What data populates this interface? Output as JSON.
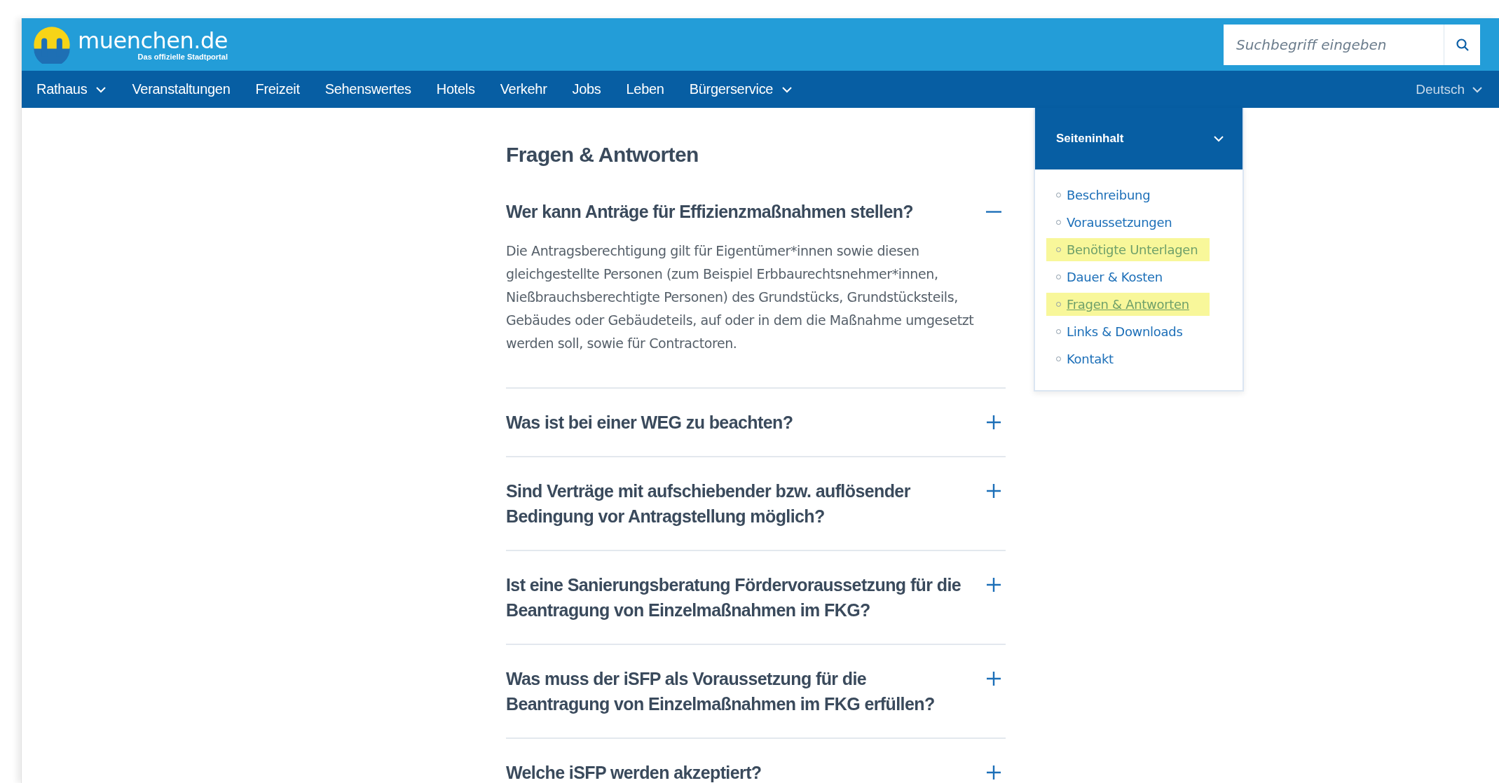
{
  "header": {
    "logo_text": "muenchen.de",
    "logo_tagline": "Das offizielle Stadtportal",
    "search": {
      "placeholder": "Suchbegriff eingeben"
    }
  },
  "nav": {
    "items": [
      {
        "label": "Rathaus",
        "dropdown": true
      },
      {
        "label": "Veranstaltungen",
        "dropdown": false
      },
      {
        "label": "Freizeit",
        "dropdown": false
      },
      {
        "label": "Sehenswertes",
        "dropdown": false
      },
      {
        "label": "Hotels",
        "dropdown": false
      },
      {
        "label": "Verkehr",
        "dropdown": false
      },
      {
        "label": "Jobs",
        "dropdown": false
      },
      {
        "label": "Leben",
        "dropdown": false
      },
      {
        "label": "Bürgerservice",
        "dropdown": true
      }
    ],
    "language": "Deutsch"
  },
  "section_title": "Fragen & Antworten",
  "faq": [
    {
      "question": "Wer kann Anträge für Effizienzmaßnahmen stellen?",
      "expanded": true,
      "answer": "Die Antragsberechtigung gilt für Eigentümer*innen sowie diesen gleichgestellte Personen (zum Beispiel Erbbaurechtsnehmer*innen, Nießbrauchsberechtigte Personen) des Grundstücks, Grundstücksteils, Gebäudes oder Gebäudeteils, auf oder in dem die Maßnahme umgesetzt werden soll, sowie für Contractoren."
    },
    {
      "question": "Was ist bei einer WEG zu beachten?",
      "expanded": false
    },
    {
      "question": "Sind Verträge mit aufschiebender bzw. auflösender Bedingung vor Antragstellung möglich?",
      "expanded": false
    },
    {
      "question": "Ist eine Sanierungsberatung Fördervoraussetzung für die Beantragung von Einzelmaßnahmen im FKG?",
      "expanded": false
    },
    {
      "question": "Was muss der iSFP als Voraussetzung für die Beantragung von Einzelmaßnahmen im FKG erfüllen?",
      "expanded": false
    },
    {
      "question": "Welche iSFP werden akzeptiert?",
      "expanded": false
    }
  ],
  "toc": {
    "title": "Seiteninhalt",
    "expanded": true,
    "items": [
      {
        "label": "Beschreibung",
        "highlighted": false,
        "selected": false
      },
      {
        "label": "Voraussetzungen",
        "highlighted": false,
        "selected": false
      },
      {
        "label": "Benötigte Unterlagen",
        "highlighted": true,
        "selected": false
      },
      {
        "label": "Dauer & Kosten",
        "highlighted": false,
        "selected": false
      },
      {
        "label": "Fragen & Antworten",
        "highlighted": true,
        "selected": true
      },
      {
        "label": "Links & Downloads",
        "highlighted": false,
        "selected": false
      },
      {
        "label": "Kontakt",
        "highlighted": false,
        "selected": false
      }
    ]
  }
}
